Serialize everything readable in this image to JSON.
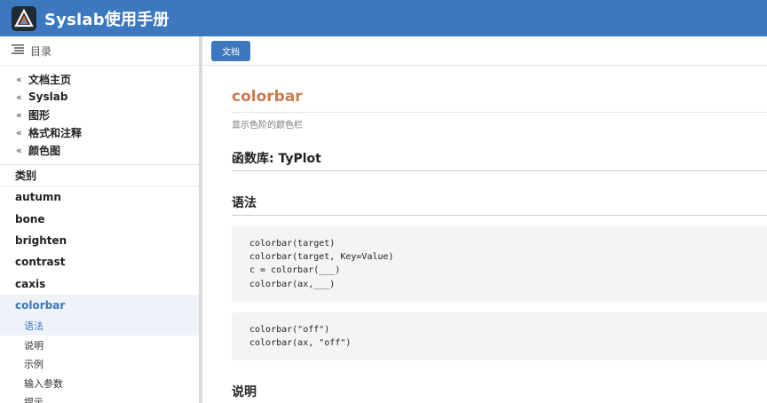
{
  "app": {
    "title": "Syslab使用手册",
    "accent": "#3b78bf",
    "icons": {
      "logo": "syslab-logo-icon",
      "menu": "toc-list-icon",
      "back": "double-chevron-left-icon"
    }
  },
  "sidebar": {
    "toc_label": "目录",
    "breadcrumbs": [
      "文档主页",
      "Syslab",
      "图形",
      "格式和注释",
      "颜色图"
    ],
    "category": "类别",
    "items": [
      "autumn",
      "bone",
      "brighten",
      "contrast",
      "caxis",
      "colorbar"
    ],
    "active_item": "colorbar",
    "subitems": [
      "语法",
      "说明",
      "示例",
      "输入参数",
      "提示"
    ],
    "active_subitem": "语法"
  },
  "main": {
    "tab_label": "文档",
    "title": "colorbar",
    "summary": "显示色阶的颜色栏",
    "library_heading": "函数库: TyPlot",
    "syntax_heading": "语法",
    "code_block_1": [
      "colorbar(target)",
      "colorbar(target, Key=Value)",
      "c = colorbar(___)",
      "colorbar(ax,___)"
    ],
    "code_block_2": [
      "colorbar(\"off\")",
      "colorbar(ax, \"off\")"
    ],
    "description_heading": "说明"
  }
}
